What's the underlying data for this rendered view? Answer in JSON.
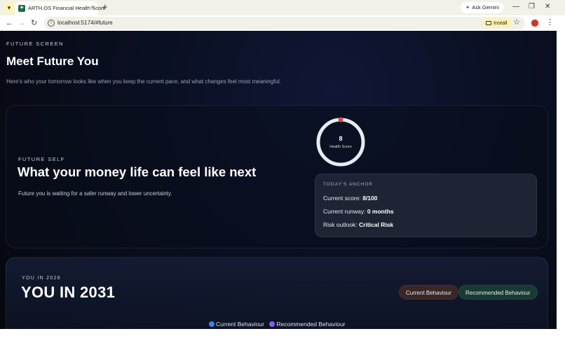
{
  "browser": {
    "tab_title": "ARTH.OS Financial Health Score",
    "tab_close": "×",
    "new_tab": "+",
    "ask_gemini": "Ask Gemini",
    "url": "localhost:5174/#future",
    "install": "Install",
    "back_icon": "←",
    "forward_icon": "→",
    "reload_icon": "↻",
    "star_icon": "☆",
    "kebab_icon": "⋮",
    "minimize_icon": "—",
    "restore_icon": "❐",
    "close_icon": "✕"
  },
  "page": {
    "eyebrow": "FUTURE SCREEN",
    "title": "Meet Future You",
    "subtitle": "Here's who your tomorrow looks like when you keep the current pace, and what changes feel most meaningful."
  },
  "future_self": {
    "eyebrow": "FUTURE SELF",
    "heading": "What your money life can feel like next",
    "body": "Future you is waiting for a safer runway and lower uncertainty.",
    "gauge": {
      "value": "8",
      "label": "Health Score",
      "score_fraction": 0.08,
      "ring_color": "#e8ebf0",
      "marker_color": "#e0474c"
    },
    "anchor": {
      "eyebrow": "TODAY'S ANCHOR",
      "score_label": "Current score: ",
      "score_value": "8/100",
      "runway_label": "Current runway: ",
      "runway_value": "0 months",
      "risk_label": "Risk outlook: ",
      "risk_value": "Critical Risk"
    }
  },
  "projection": {
    "eyebrow": "YOU IN 2026",
    "title": "YOU IN 2031",
    "pill_current": "Current Behaviour",
    "pill_recommended": "Recommended Behaviour",
    "legend": [
      {
        "label": "Current Behaviour",
        "color": "#3b82f6"
      },
      {
        "label": "Recommended Behaviour",
        "color": "#8b5cf6"
      }
    ]
  }
}
